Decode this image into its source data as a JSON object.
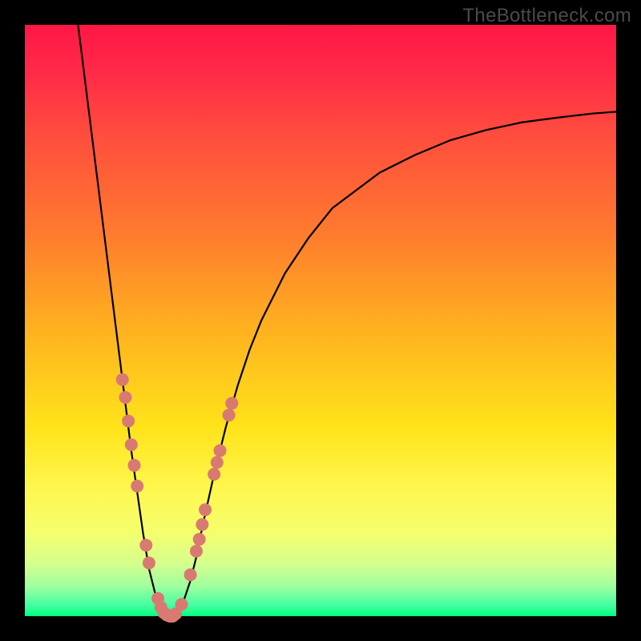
{
  "watermark": "TheBottleneck.com",
  "colors": {
    "frame": "#000000",
    "curve": "#000000",
    "dot": "#d87a72",
    "gradient_top": "#ff1744",
    "gradient_bottom": "#00ff7f"
  },
  "chart_data": {
    "type": "line",
    "title": "",
    "xlabel": "",
    "ylabel": "",
    "xlim": [
      0,
      100
    ],
    "ylim": [
      0,
      100
    ],
    "series": [
      {
        "name": "bottleneck-curve",
        "x": [
          9,
          10,
          11,
          12,
          13,
          14,
          15,
          16,
          17,
          18,
          19,
          20,
          21,
          22,
          23,
          24,
          25,
          26,
          27,
          28,
          29,
          30,
          32,
          34,
          36,
          38,
          40,
          44,
          48,
          52,
          56,
          60,
          66,
          72,
          78,
          84,
          90,
          96,
          100
        ],
        "values": [
          100,
          92,
          84,
          76,
          68,
          60,
          52,
          44,
          36,
          28,
          21,
          14,
          8,
          4,
          1,
          0,
          0,
          1,
          3,
          6,
          10,
          15,
          24,
          32,
          39,
          45,
          50,
          58,
          64,
          69,
          72,
          75,
          78,
          80.5,
          82.2,
          83.5,
          84.3,
          85,
          85.3
        ]
      }
    ],
    "dots": {
      "name": "highlighted-points",
      "points": [
        {
          "x": 16.5,
          "y": 40
        },
        {
          "x": 17,
          "y": 37
        },
        {
          "x": 17.5,
          "y": 33
        },
        {
          "x": 18,
          "y": 29
        },
        {
          "x": 18.5,
          "y": 25.5
        },
        {
          "x": 19,
          "y": 22
        },
        {
          "x": 20.5,
          "y": 12
        },
        {
          "x": 21,
          "y": 9
        },
        {
          "x": 22.5,
          "y": 3
        },
        {
          "x": 23,
          "y": 1.5
        },
        {
          "x": 23.5,
          "y": 0.6
        },
        {
          "x": 24,
          "y": 0.2
        },
        {
          "x": 24.5,
          "y": 0
        },
        {
          "x": 25,
          "y": 0
        },
        {
          "x": 25.5,
          "y": 0.4
        },
        {
          "x": 26.5,
          "y": 2
        },
        {
          "x": 28,
          "y": 7
        },
        {
          "x": 29,
          "y": 11
        },
        {
          "x": 29.5,
          "y": 13
        },
        {
          "x": 30,
          "y": 15.5
        },
        {
          "x": 30.5,
          "y": 18
        },
        {
          "x": 32,
          "y": 24
        },
        {
          "x": 32.5,
          "y": 26
        },
        {
          "x": 33,
          "y": 28
        },
        {
          "x": 34.5,
          "y": 34
        },
        {
          "x": 35,
          "y": 36
        }
      ]
    }
  }
}
